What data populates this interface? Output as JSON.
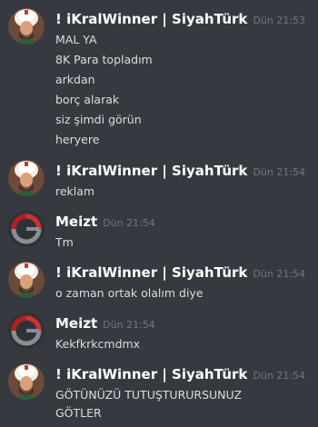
{
  "messages": [
    {
      "author": "! iKralWinner | SiyahTürk",
      "avatar": "sultan-avatar-icon",
      "time": "Dün 21:53",
      "lines": [
        "MAL YA",
        "8K Para topladım",
        "arkdan",
        "borç alarak",
        "siz şimdi görün",
        "heryere"
      ]
    },
    {
      "author": "! iKralWinner | SiyahTürk",
      "avatar": "sultan-avatar-icon",
      "time": "Dün 21:54",
      "lines": [
        "reklam"
      ]
    },
    {
      "author": "Meizt",
      "avatar": "g-logo-avatar-icon",
      "time": "Dün 21:54",
      "lines": [
        "Tm"
      ]
    },
    {
      "author": "! iKralWinner | SiyahTürk",
      "avatar": "sultan-avatar-icon",
      "time": "Dün 21:54",
      "lines": [
        "o zaman ortak olalım diye"
      ]
    },
    {
      "author": "Meizt",
      "avatar": "g-logo-avatar-icon",
      "time": "Dün 21:54",
      "lines": [
        "Kekfkrkcmdmx"
      ]
    },
    {
      "author": "! iKralWinner | SiyahTürk",
      "avatar": "sultan-avatar-icon",
      "time": "Dün 21:54",
      "lines": [
        "GÖTÜNÜZÜ TUTUŞTURURSUNUZ",
        "GÖTLER"
      ]
    }
  ],
  "colors": {
    "background": "#36393f",
    "username": "#ffffff",
    "timestamp": "#72767d",
    "message_text": "#dcddde"
  }
}
